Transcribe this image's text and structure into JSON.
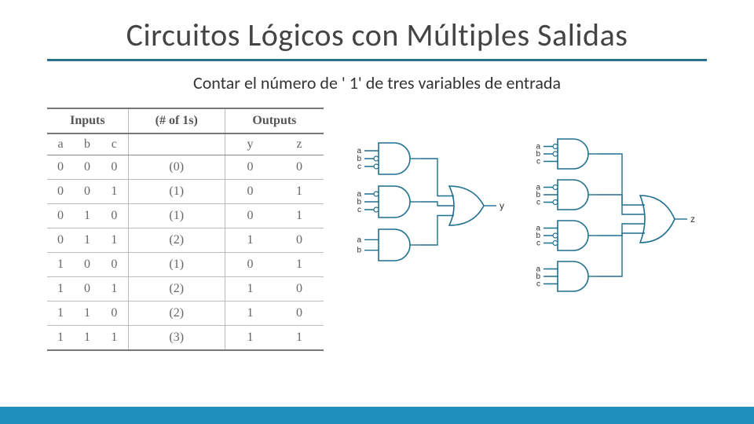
{
  "title": "Circuitos Lógicos con Múltiples Salidas",
  "subtitle": "Contar el número de ' 1' de tres variables de entrada",
  "table": {
    "head_inputs": "Inputs",
    "head_count": "(# of 1s)",
    "head_outputs": "Outputs",
    "sub": [
      "a",
      "b",
      "c",
      "",
      "y",
      "z"
    ],
    "rows": [
      {
        "a": "0",
        "b": "0",
        "c": "0",
        "n": "(0)",
        "y": "0",
        "z": "0"
      },
      {
        "a": "0",
        "b": "0",
        "c": "1",
        "n": "(1)",
        "y": "0",
        "z": "1"
      },
      {
        "a": "0",
        "b": "1",
        "c": "0",
        "n": "(1)",
        "y": "0",
        "z": "1"
      },
      {
        "a": "0",
        "b": "1",
        "c": "1",
        "n": "(2)",
        "y": "1",
        "z": "0"
      },
      {
        "a": "1",
        "b": "0",
        "c": "0",
        "n": "(1)",
        "y": "0",
        "z": "1"
      },
      {
        "a": "1",
        "b": "0",
        "c": "1",
        "n": "(2)",
        "y": "1",
        "z": "0"
      },
      {
        "a": "1",
        "b": "1",
        "c": "0",
        "n": "(2)",
        "y": "1",
        "z": "0"
      },
      {
        "a": "1",
        "b": "1",
        "c": "1",
        "n": "(3)",
        "y": "1",
        "z": "1"
      }
    ]
  },
  "circuit_y": {
    "gates": [
      {
        "inputs": [
          "a",
          "b",
          "c"
        ],
        "inv": [
          false,
          true,
          true
        ]
      },
      {
        "inputs": [
          "a",
          "b",
          "c"
        ],
        "inv": [
          true,
          false,
          true
        ]
      },
      {
        "inputs": [
          "a",
          "b"
        ],
        "inv": [
          false,
          false
        ]
      }
    ],
    "output": "y"
  },
  "circuit_z": {
    "gates": [
      {
        "inputs": [
          "a",
          "b",
          "c"
        ],
        "inv": [
          true,
          true,
          false
        ]
      },
      {
        "inputs": [
          "a",
          "b",
          "c"
        ],
        "inv": [
          true,
          false,
          true
        ]
      },
      {
        "inputs": [
          "a",
          "b",
          "c"
        ],
        "inv": [
          false,
          true,
          true
        ]
      },
      {
        "inputs": [
          "a",
          "b",
          "c"
        ],
        "inv": [
          false,
          false,
          false
        ]
      }
    ],
    "output": "z"
  },
  "colors": {
    "stroke": "#1f6f8f",
    "footer": "#1f8fbf"
  }
}
